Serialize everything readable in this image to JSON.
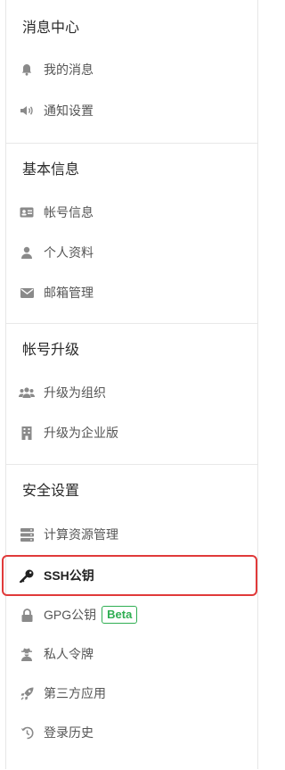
{
  "sections": [
    {
      "title": "消息中心",
      "items": [
        {
          "label": "我的消息",
          "icon": "bell-icon"
        },
        {
          "label": "通知设置",
          "icon": "speaker-icon"
        }
      ]
    },
    {
      "title": "基本信息",
      "items": [
        {
          "label": "帐号信息",
          "icon": "id-card-icon"
        },
        {
          "label": "个人资料",
          "icon": "user-icon"
        },
        {
          "label": "邮箱管理",
          "icon": "envelope-icon"
        }
      ]
    },
    {
      "title": "帐号升级",
      "items": [
        {
          "label": "升级为组织",
          "icon": "users-icon"
        },
        {
          "label": "升级为企业版",
          "icon": "building-icon"
        }
      ]
    },
    {
      "title": "安全设置",
      "items": [
        {
          "label": "计算资源管理",
          "icon": "server-icon"
        },
        {
          "label": "SSH公钥",
          "icon": "key-icon",
          "active": true
        },
        {
          "label": "GPG公钥",
          "icon": "lock-icon",
          "badge": "Beta"
        },
        {
          "label": "私人令牌",
          "icon": "user-secret-icon"
        },
        {
          "label": "第三方应用",
          "icon": "rocket-icon"
        },
        {
          "label": "登录历史",
          "icon": "history-icon"
        }
      ]
    }
  ],
  "colors": {
    "highlight_border": "#e03a3a",
    "badge_green": "#2fae52"
  }
}
